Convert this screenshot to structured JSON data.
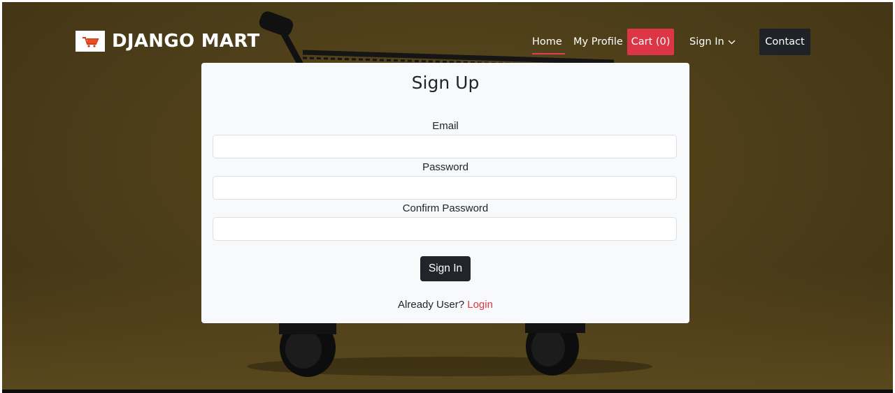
{
  "brand": {
    "name": "DJANGO MART",
    "logo_icon": "shopping-cart-icon"
  },
  "nav": {
    "home": "Home",
    "profile": "My Profile",
    "cart": "Cart (0)",
    "signin": "Sign In",
    "contact": "Contact"
  },
  "form": {
    "title": "Sign Up",
    "email_label": "Email",
    "email_value": "",
    "password_label": "Password",
    "password_value": "",
    "confirm_label": "Confirm Password",
    "confirm_value": "",
    "submit_label": "Sign In",
    "already_text": "Already User?",
    "login_link": "Login"
  },
  "colors": {
    "accent": "#dc3545",
    "dark": "#1f2227",
    "card": "#f8f9fa",
    "background": "#4e3f1a"
  }
}
